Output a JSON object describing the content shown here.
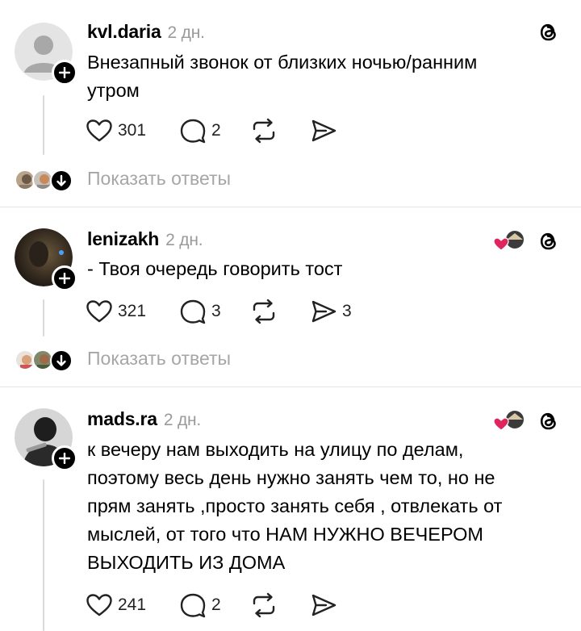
{
  "posts": [
    {
      "username": "kvl.daria",
      "time": "2 дн.",
      "text_lines": [
        "Внезапный звонок от близких ночью/ранним",
        "утром"
      ],
      "likes": "301",
      "comments": "2",
      "reposts": "",
      "shares": "",
      "avatar": "default-avatar"
    },
    {
      "username": "lenizakh",
      "time": "2 дн.",
      "text_lines": [
        "- Твоя очередь говорить тост"
      ],
      "likes": "321",
      "comments": "3",
      "reposts": "",
      "shares": "3",
      "avatar": "photo-avatar-dark"
    },
    {
      "username": "mads.ra",
      "time": "2 дн.",
      "text_lines": [
        "к вечеру нам выходить на улицу по делам,",
        "поэтому весь день нужно занять чем то, но не",
        "прям занять ,просто занять себя , отвлекать от",
        "мыслей, от того что НАМ НУЖНО ВЕЧЕРОМ",
        "ВЫХОДИТЬ ИЗ ДОМА"
      ],
      "likes": "241",
      "comments": "2",
      "reposts": "",
      "shares": "",
      "avatar": "photo-avatar-bw"
    }
  ],
  "replies": [
    {
      "label": "Показать ответы"
    },
    {
      "label": "Показать ответы"
    }
  ],
  "icons": {
    "like": "heart-icon",
    "comment": "comment-bubble-icon",
    "repost": "repost-arrows-icon",
    "share": "send-icon",
    "app": "threads-logo-icon",
    "follow": "plus-icon",
    "expand": "arrow-down-icon",
    "liked_by_author": "red-heart-icon"
  },
  "colors": {
    "text": "#000000",
    "muted": "#9a9a9a",
    "divider": "#e6e6e6",
    "heart": "#e0245e"
  }
}
